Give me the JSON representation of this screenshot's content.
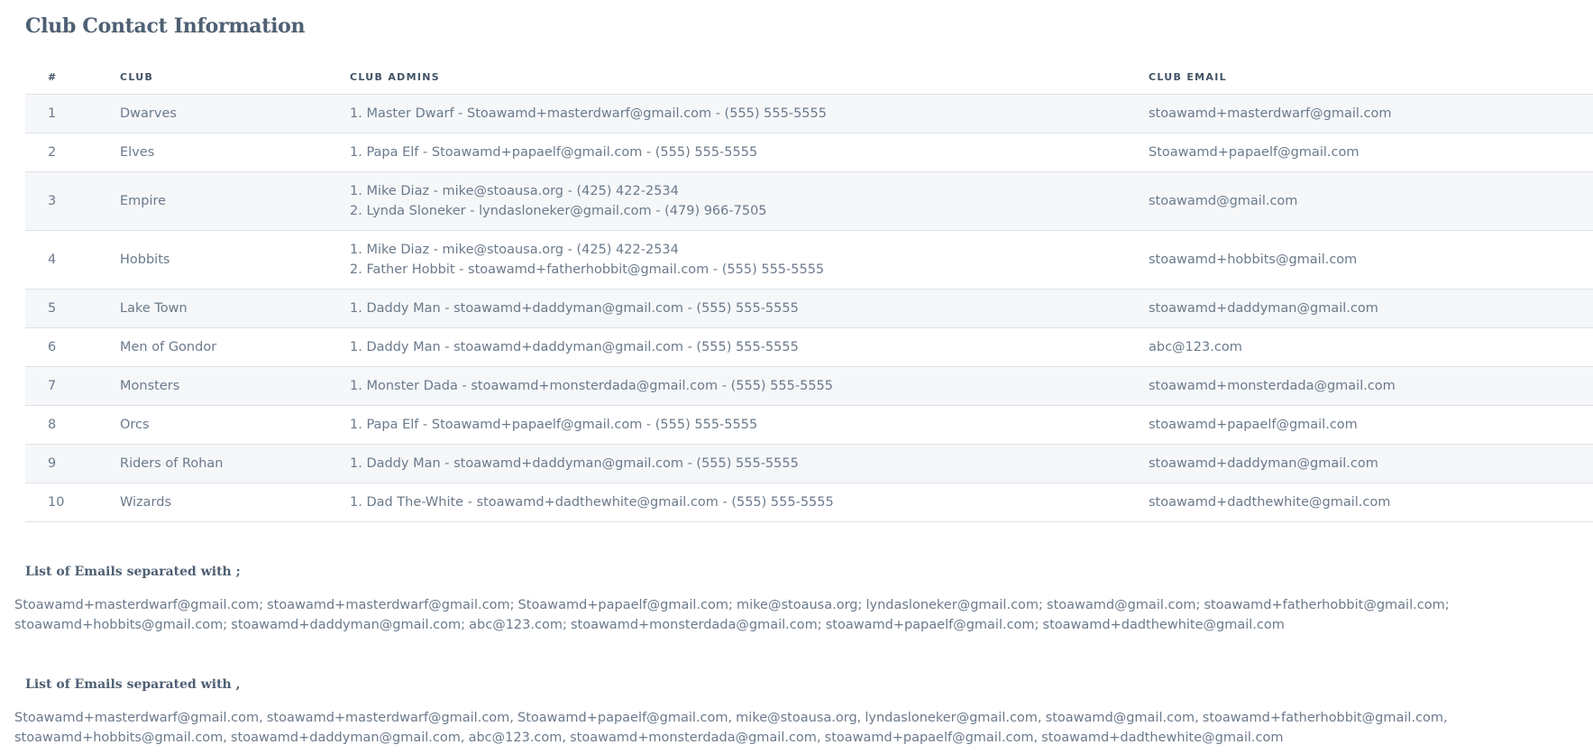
{
  "page": {
    "title": "Club Contact Information"
  },
  "table": {
    "columns": [
      "#",
      "CLUB",
      "CLUB ADMINS",
      "CLUB EMAIL"
    ],
    "rows": [
      {
        "num": "1",
        "club": "Dwarves",
        "admins": [
          "1. Master Dwarf - Stoawamd+masterdwarf@gmail.com - (555) 555-5555"
        ],
        "email": "stoawamd+masterdwarf@gmail.com"
      },
      {
        "num": "2",
        "club": "Elves",
        "admins": [
          "1. Papa Elf - Stoawamd+papaelf@gmail.com - (555) 555-5555"
        ],
        "email": "Stoawamd+papaelf@gmail.com"
      },
      {
        "num": "3",
        "club": "Empire",
        "admins": [
          "1. Mike Diaz - mike@stoausa.org - (425) 422-2534",
          "2. Lynda Sloneker - lyndasloneker@gmail.com - (479) 966-7505"
        ],
        "email": "stoawamd@gmail.com"
      },
      {
        "num": "4",
        "club": "Hobbits",
        "admins": [
          "1. Mike Diaz - mike@stoausa.org - (425) 422-2534",
          "2. Father Hobbit - stoawamd+fatherhobbit@gmail.com - (555) 555-5555"
        ],
        "email": "stoawamd+hobbits@gmail.com"
      },
      {
        "num": "5",
        "club": "Lake Town",
        "admins": [
          "1. Daddy Man - stoawamd+daddyman@gmail.com - (555) 555-5555"
        ],
        "email": "stoawamd+daddyman@gmail.com"
      },
      {
        "num": "6",
        "club": "Men of Gondor",
        "admins": [
          "1. Daddy Man - stoawamd+daddyman@gmail.com - (555) 555-5555"
        ],
        "email": "abc@123.com"
      },
      {
        "num": "7",
        "club": "Monsters",
        "admins": [
          "1. Monster Dada - stoawamd+monsterdada@gmail.com - (555) 555-5555"
        ],
        "email": "stoawamd+monsterdada@gmail.com"
      },
      {
        "num": "8",
        "club": "Orcs",
        "admins": [
          "1. Papa Elf - Stoawamd+papaelf@gmail.com - (555) 555-5555"
        ],
        "email": "stoawamd+papaelf@gmail.com"
      },
      {
        "num": "9",
        "club": "Riders of Rohan",
        "admins": [
          "1. Daddy Man - stoawamd+daddyman@gmail.com - (555) 555-5555"
        ],
        "email": "stoawamd+daddyman@gmail.com"
      },
      {
        "num": "10",
        "club": "Wizards",
        "admins": [
          "1. Dad The-White - stoawamd+dadthewhite@gmail.com - (555) 555-5555"
        ],
        "email": "stoawamd+dadthewhite@gmail.com"
      }
    ]
  },
  "semicolon_list": {
    "heading": "List of Emails separated with ;",
    "text": "Stoawamd+masterdwarf@gmail.com; stoawamd+masterdwarf@gmail.com; Stoawamd+papaelf@gmail.com; mike@stoausa.org; lyndasloneker@gmail.com; stoawamd@gmail.com; stoawamd+fatherhobbit@gmail.com; stoawamd+hobbits@gmail.com; stoawamd+daddyman@gmail.com; abc@123.com; stoawamd+monsterdada@gmail.com; stoawamd+papaelf@gmail.com; stoawamd+dadthewhite@gmail.com"
  },
  "comma_list": {
    "heading": "List of Emails separated with ,",
    "text": "Stoawamd+masterdwarf@gmail.com, stoawamd+masterdwarf@gmail.com, Stoawamd+papaelf@gmail.com, mike@stoausa.org, lyndasloneker@gmail.com, stoawamd@gmail.com, stoawamd+fatherhobbit@gmail.com, stoawamd+hobbits@gmail.com, stoawamd+daddyman@gmail.com, abc@123.com, stoawamd+monsterdada@gmail.com, stoawamd+papaelf@gmail.com, stoawamd+dadthewhite@gmail.com"
  }
}
